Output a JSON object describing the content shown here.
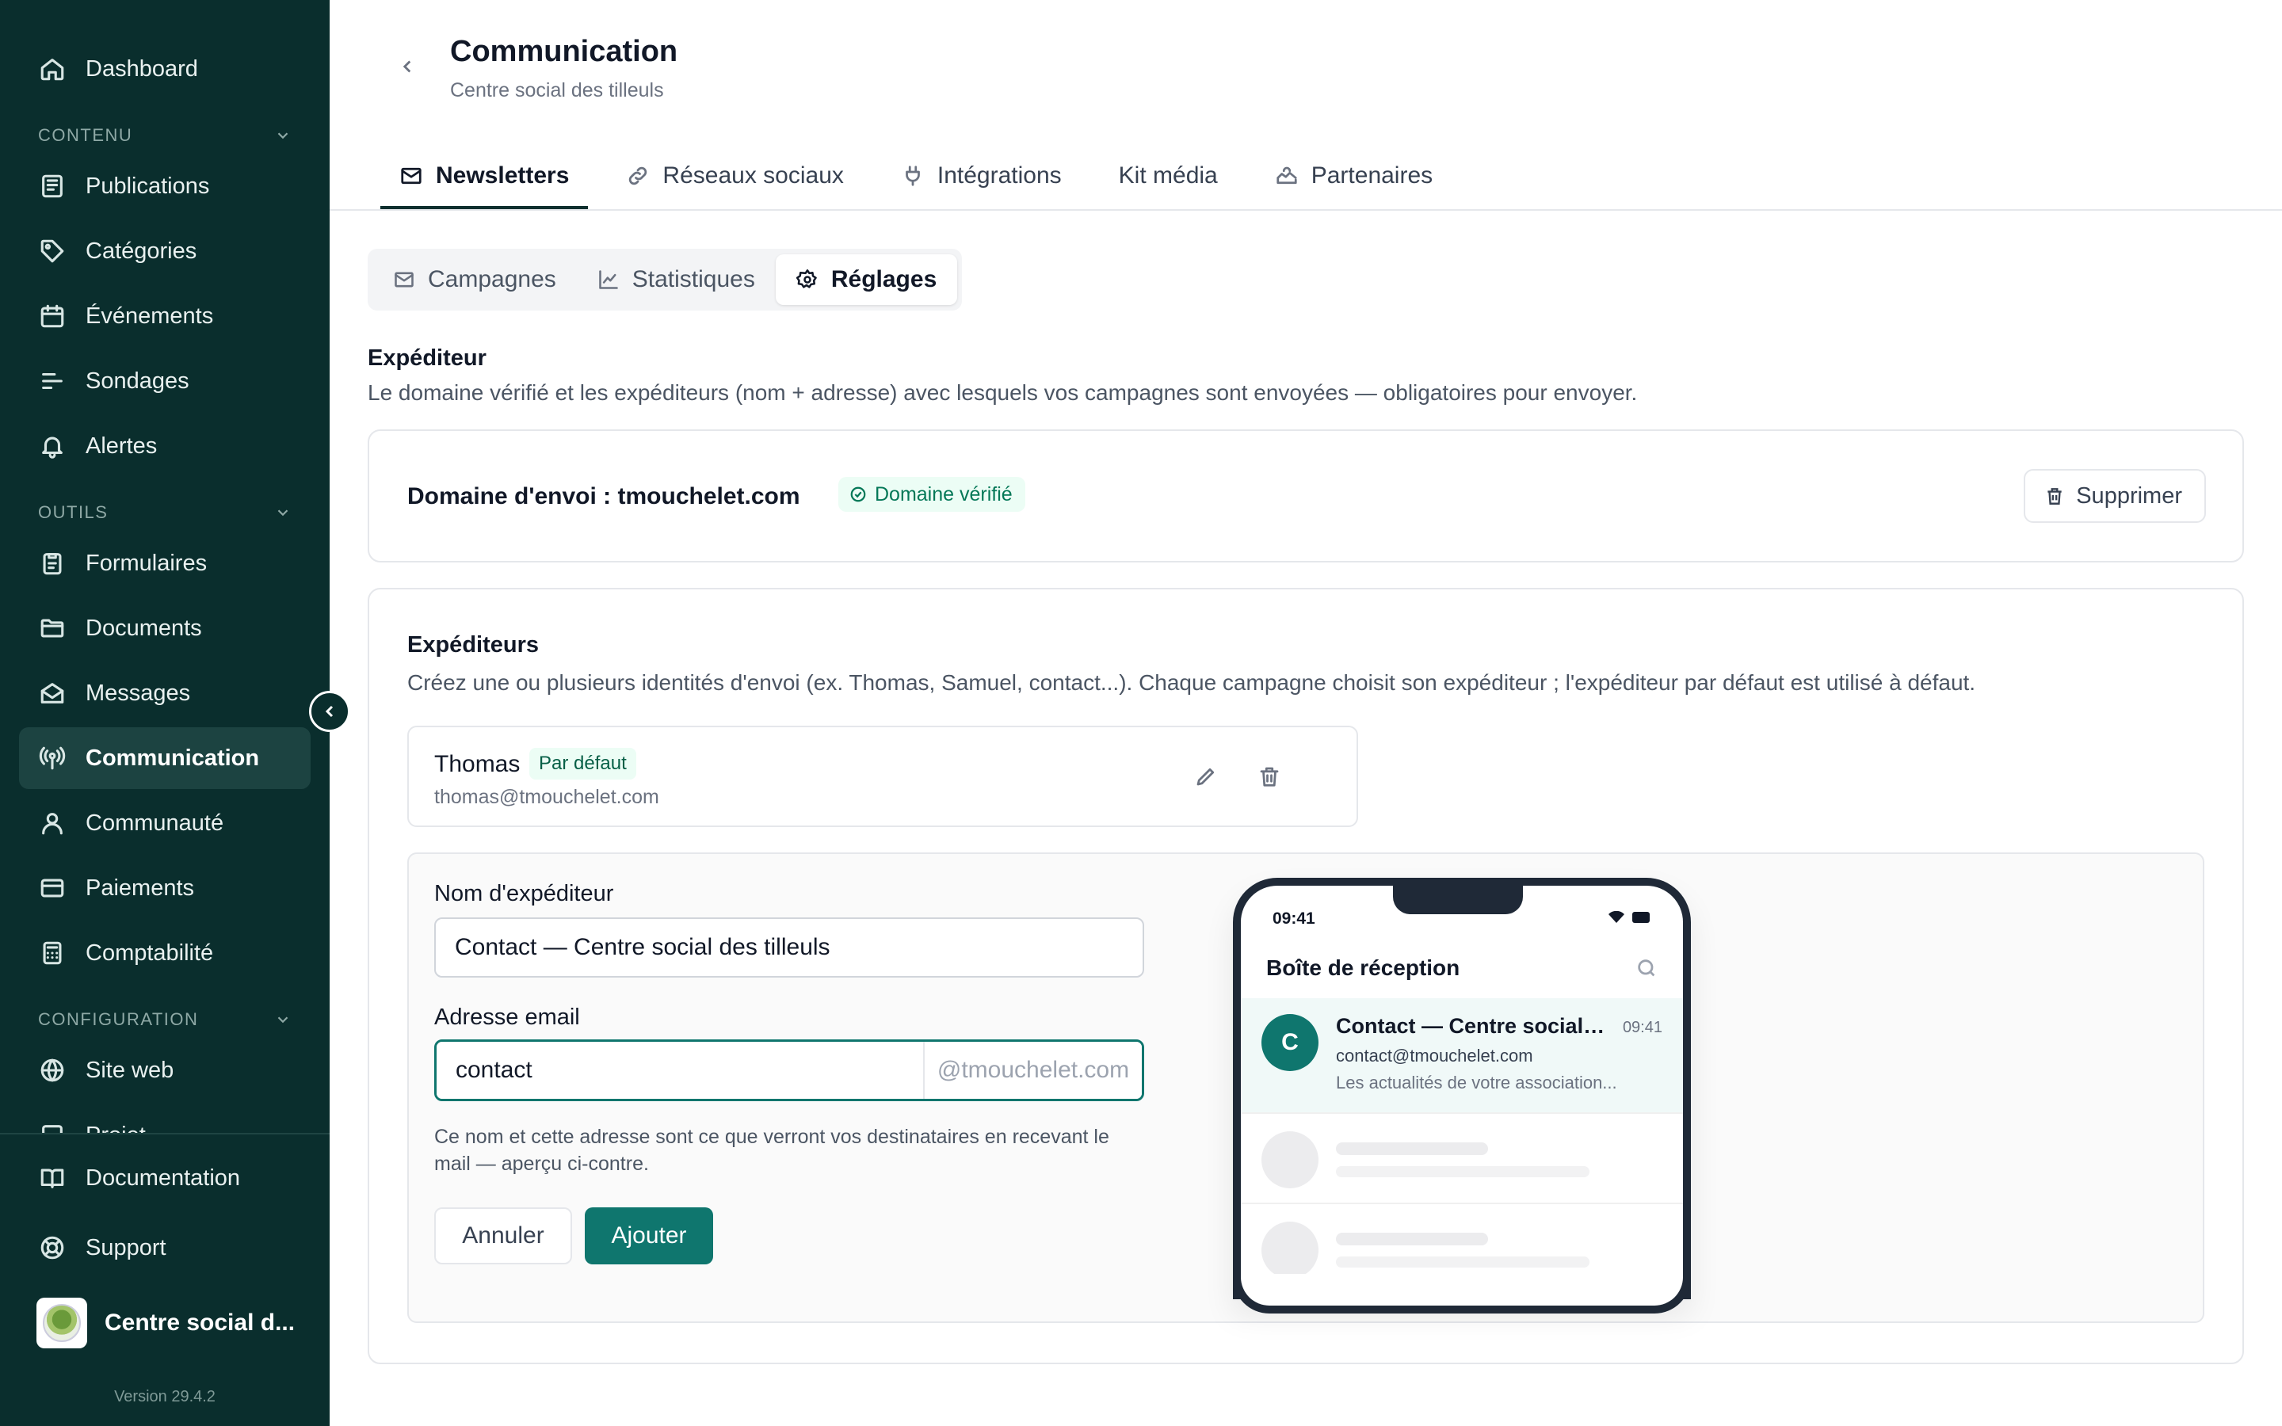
{
  "sidebar": {
    "items": {
      "dashboard": "Dashboard",
      "publications": "Publications",
      "categories": "Catégories",
      "evenements": "Événements",
      "sondages": "Sondages",
      "alertes": "Alertes",
      "formulaires": "Formulaires",
      "documents": "Documents",
      "messages": "Messages",
      "communication": "Communication",
      "communaute": "Communauté",
      "paiements": "Paiements",
      "comptabilite": "Comptabilité",
      "site_web": "Site web",
      "projet": "Projet",
      "documentation": "Documentation",
      "support": "Support"
    },
    "sections": {
      "contenu": "CONTENU",
      "outils": "OUTILS",
      "configuration": "CONFIGURATION"
    },
    "active_item": "communication",
    "org_name": "Centre social d...",
    "version": "Version 29.4.2"
  },
  "header": {
    "title": "Communication",
    "subtitle": "Centre social des tilleuls"
  },
  "tabs": {
    "newsletters": "Newsletters",
    "reseaux": "Réseaux sociaux",
    "integrations": "Intégrations",
    "kit": "Kit média",
    "partenaires": "Partenaires",
    "active": "newsletters"
  },
  "subtabs": {
    "campagnes": "Campagnes",
    "statistiques": "Statistiques",
    "reglages": "Réglages",
    "active": "reglages"
  },
  "expediteur": {
    "title": "Expéditeur",
    "description": "Le domaine vérifié et les expéditeurs (nom + adresse) avec lesquels vos campagnes sont envoyées — obligatoires pour envoyer.",
    "domain_label": "Domaine d'envoi : tmouchelet.com",
    "verified_badge": "Domaine vérifié",
    "delete_button": "Supprimer"
  },
  "senders": {
    "title": "Expéditeurs",
    "description": "Créez une ou plusieurs identités d'envoi (ex. Thomas, Samuel, contact...). Chaque campagne choisit son expéditeur ; l'expéditeur par défaut est utilisé à défaut.",
    "list": [
      {
        "name": "Thomas",
        "badge": "Par défaut",
        "email": "thomas@tmouchelet.com"
      }
    ]
  },
  "form": {
    "name_label": "Nom d'expéditeur",
    "name_value": "Contact — Centre social des tilleuls",
    "email_label": "Adresse email",
    "email_value": "contact",
    "email_suffix": "@tmouchelet.com",
    "help": "Ce nom et cette adresse sont ce que verront vos destinataires en recevant le mail — aperçu ci-contre.",
    "cancel": "Annuler",
    "submit": "Ajouter"
  },
  "preview": {
    "time": "09:41",
    "inbox_title": "Boîte de réception",
    "avatar_letter": "C",
    "from": "Contact — Centre social ...",
    "msg_time": "09:41",
    "address": "contact@tmouchelet.com",
    "snippet": "Les actualités de votre association..."
  },
  "colors": {
    "sidebar_bg": "#0a2e2d",
    "accent": "#0f766e",
    "success_bg": "#ecfdf5",
    "success_text": "#047857"
  }
}
